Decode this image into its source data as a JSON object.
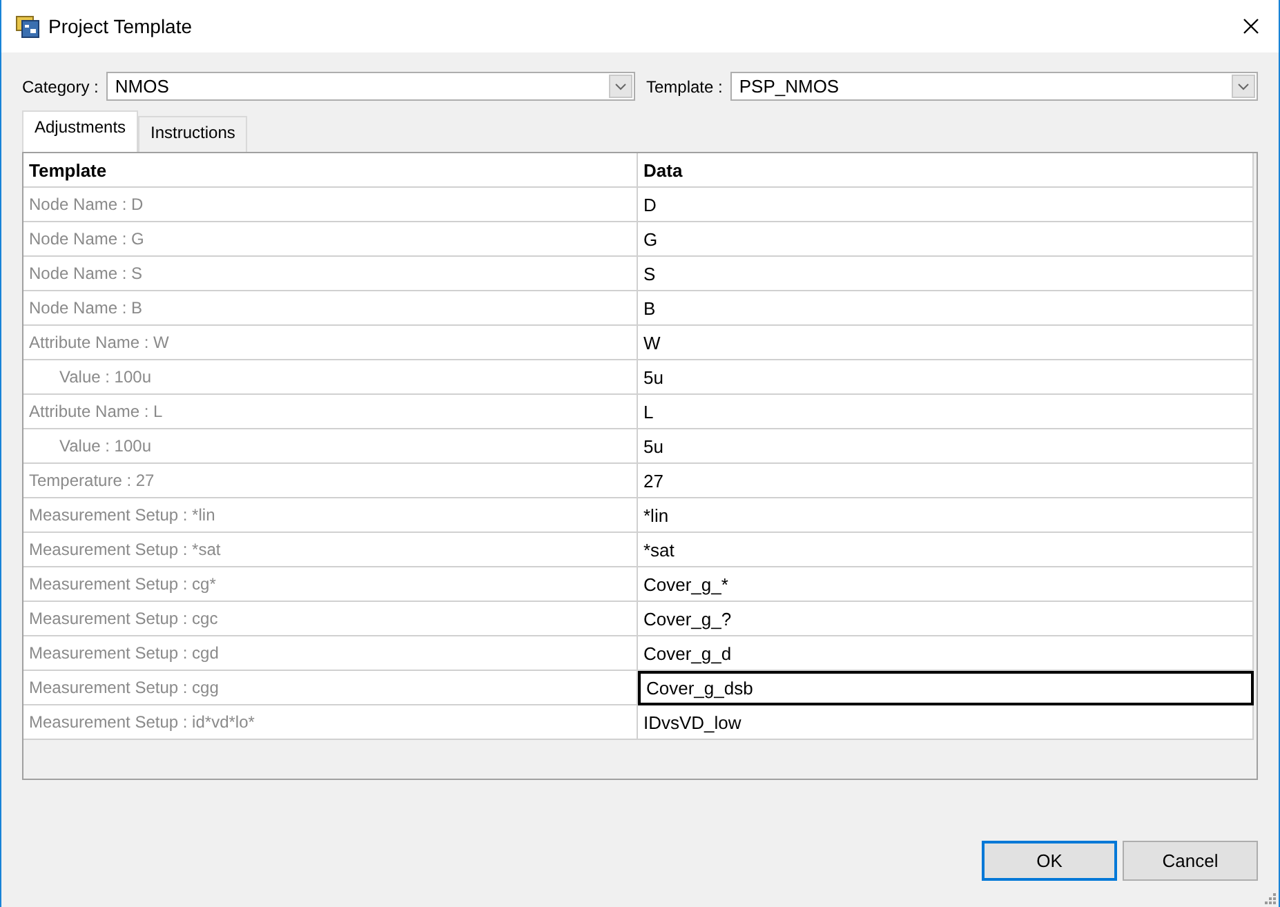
{
  "window": {
    "title": "Project Template"
  },
  "category": {
    "label": "Category :",
    "value": "NMOS"
  },
  "template": {
    "label": "Template :",
    "value": "PSP_NMOS"
  },
  "tabs": [
    {
      "label": "Adjustments",
      "selected": true
    },
    {
      "label": "Instructions",
      "selected": false
    }
  ],
  "table": {
    "columns": [
      "Template",
      "Data"
    ],
    "rows": [
      {
        "name": "Node Name : D",
        "data": "D",
        "selected": false
      },
      {
        "name": "Node Name : G",
        "data": "G",
        "selected": false
      },
      {
        "name": "Node Name : S",
        "data": "S",
        "selected": false
      },
      {
        "name": "Node Name : B",
        "data": "B",
        "selected": false
      },
      {
        "name": "Attribute Name : W",
        "data": "W",
        "selected": false,
        "children": [
          {
            "name": "Value : 100u",
            "data": "5u",
            "selected": false
          }
        ]
      },
      {
        "name": "Attribute Name : L",
        "data": "L",
        "selected": false,
        "children": [
          {
            "name": "Value : 100u",
            "data": "5u",
            "selected": false
          }
        ]
      },
      {
        "name": "Temperature : 27",
        "data": "27",
        "selected": false
      },
      {
        "name": "Measurement Setup : *lin",
        "data": "*lin",
        "selected": false
      },
      {
        "name": "Measurement Setup : *sat",
        "data": "*sat",
        "selected": false
      },
      {
        "name": "Measurement Setup : cg*",
        "data": "Cover_g_*",
        "selected": false
      },
      {
        "name": "Measurement Setup : cgc",
        "data": "Cover_g_?",
        "selected": false
      },
      {
        "name": "Measurement Setup : cgd",
        "data": "Cover_g_d",
        "selected": false
      },
      {
        "name": "Measurement Setup : cgg",
        "data": "Cover_g_dsb",
        "selected": true
      },
      {
        "name": "Measurement Setup : id*vd*lo*",
        "data": "IDvsVD_low",
        "selected": false
      }
    ]
  },
  "buttons": [
    {
      "label": "OK",
      "default": true
    },
    {
      "label": "Cancel",
      "default": false
    }
  ]
}
